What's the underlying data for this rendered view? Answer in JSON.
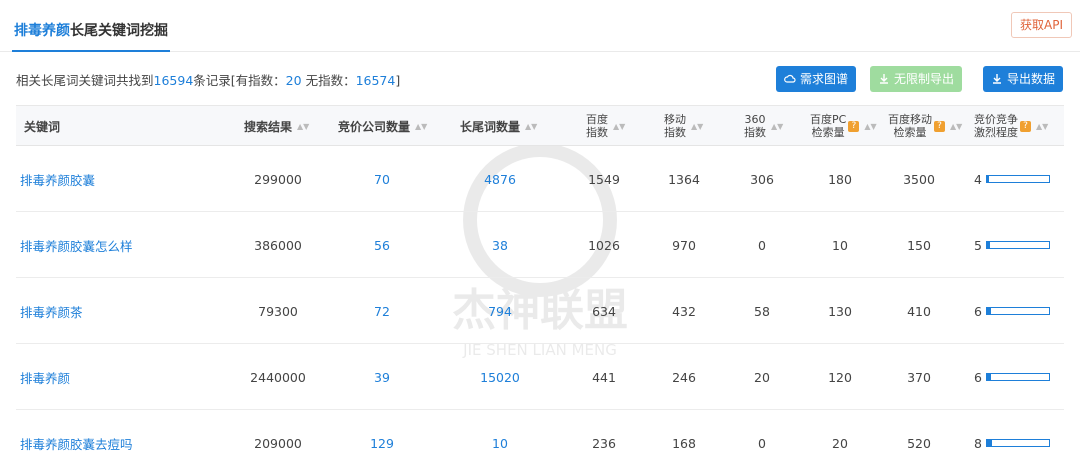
{
  "tab": {
    "highlight": "排毒养颜",
    "rest": "长尾关键词挖掘"
  },
  "api_button": "获取API",
  "summary": {
    "prefix": "相关长尾词关键词共找到",
    "total": "16594",
    "mid": "条记录[有指数：",
    "with_index": "20",
    "mid2": "无指数：",
    "without_index": "16574",
    "suffix": "]"
  },
  "buttons": {
    "cloud": "需求图谱",
    "unlimited": "无限制导出",
    "export": "导出数据"
  },
  "columns": {
    "keyword": "关键词",
    "search": "搜索结果",
    "bidding": "竞价公司数量",
    "longtail": "长尾词数量",
    "baidu_idx_1": "百度",
    "baidu_idx_2": "指数",
    "mobile_idx_1": "移动",
    "mobile_idx_2": "指数",
    "idx360_1": "360",
    "idx360_2": "指数",
    "pc_1": "百度PC",
    "pc_2": "检索量",
    "mob_1": "百度移动",
    "mob_2": "检索量",
    "comp_1": "竞价竞争",
    "comp_2": "激烈程度"
  },
  "rows": [
    {
      "keyword": "排毒养颜胶囊",
      "search": "299000",
      "bidding": "70",
      "longtail": "4876",
      "baidu": "1549",
      "mobile": "1364",
      "idx360": "306",
      "pc": "180",
      "mob": "3500",
      "comp": "4",
      "comp_level": 0.04
    },
    {
      "keyword": "排毒养颜胶囊怎么样",
      "search": "386000",
      "bidding": "56",
      "longtail": "38",
      "baidu": "1026",
      "mobile": "970",
      "idx360": "0",
      "pc": "10",
      "mob": "150",
      "comp": "5",
      "comp_level": 0.05
    },
    {
      "keyword": "排毒养颜茶",
      "search": "79300",
      "bidding": "72",
      "longtail": "794",
      "baidu": "634",
      "mobile": "432",
      "idx360": "58",
      "pc": "130",
      "mob": "410",
      "comp": "6",
      "comp_level": 0.06
    },
    {
      "keyword": "排毒养颜",
      "search": "2440000",
      "bidding": "39",
      "longtail": "15020",
      "baidu": "441",
      "mobile": "246",
      "idx360": "20",
      "pc": "120",
      "mob": "370",
      "comp": "6",
      "comp_level": 0.06
    },
    {
      "keyword": "排毒养颜胶囊去痘吗",
      "search": "209000",
      "bidding": "129",
      "longtail": "10",
      "baidu": "236",
      "mobile": "168",
      "idx360": "0",
      "pc": "20",
      "mob": "520",
      "comp": "8",
      "comp_level": 0.08
    }
  ],
  "watermark": {
    "cn": "杰神联盟",
    "en": "JIE SHEN LIAN MENG"
  },
  "colors": {
    "accent": "#1e7fd9",
    "api": "#e0633a",
    "unlimited": "#9fdc9f",
    "badge": "#f0a030"
  },
  "icons": {
    "sort": "sort-icon",
    "cloud": "cloud-icon",
    "download": "download-icon",
    "help": "help-badge-icon"
  }
}
